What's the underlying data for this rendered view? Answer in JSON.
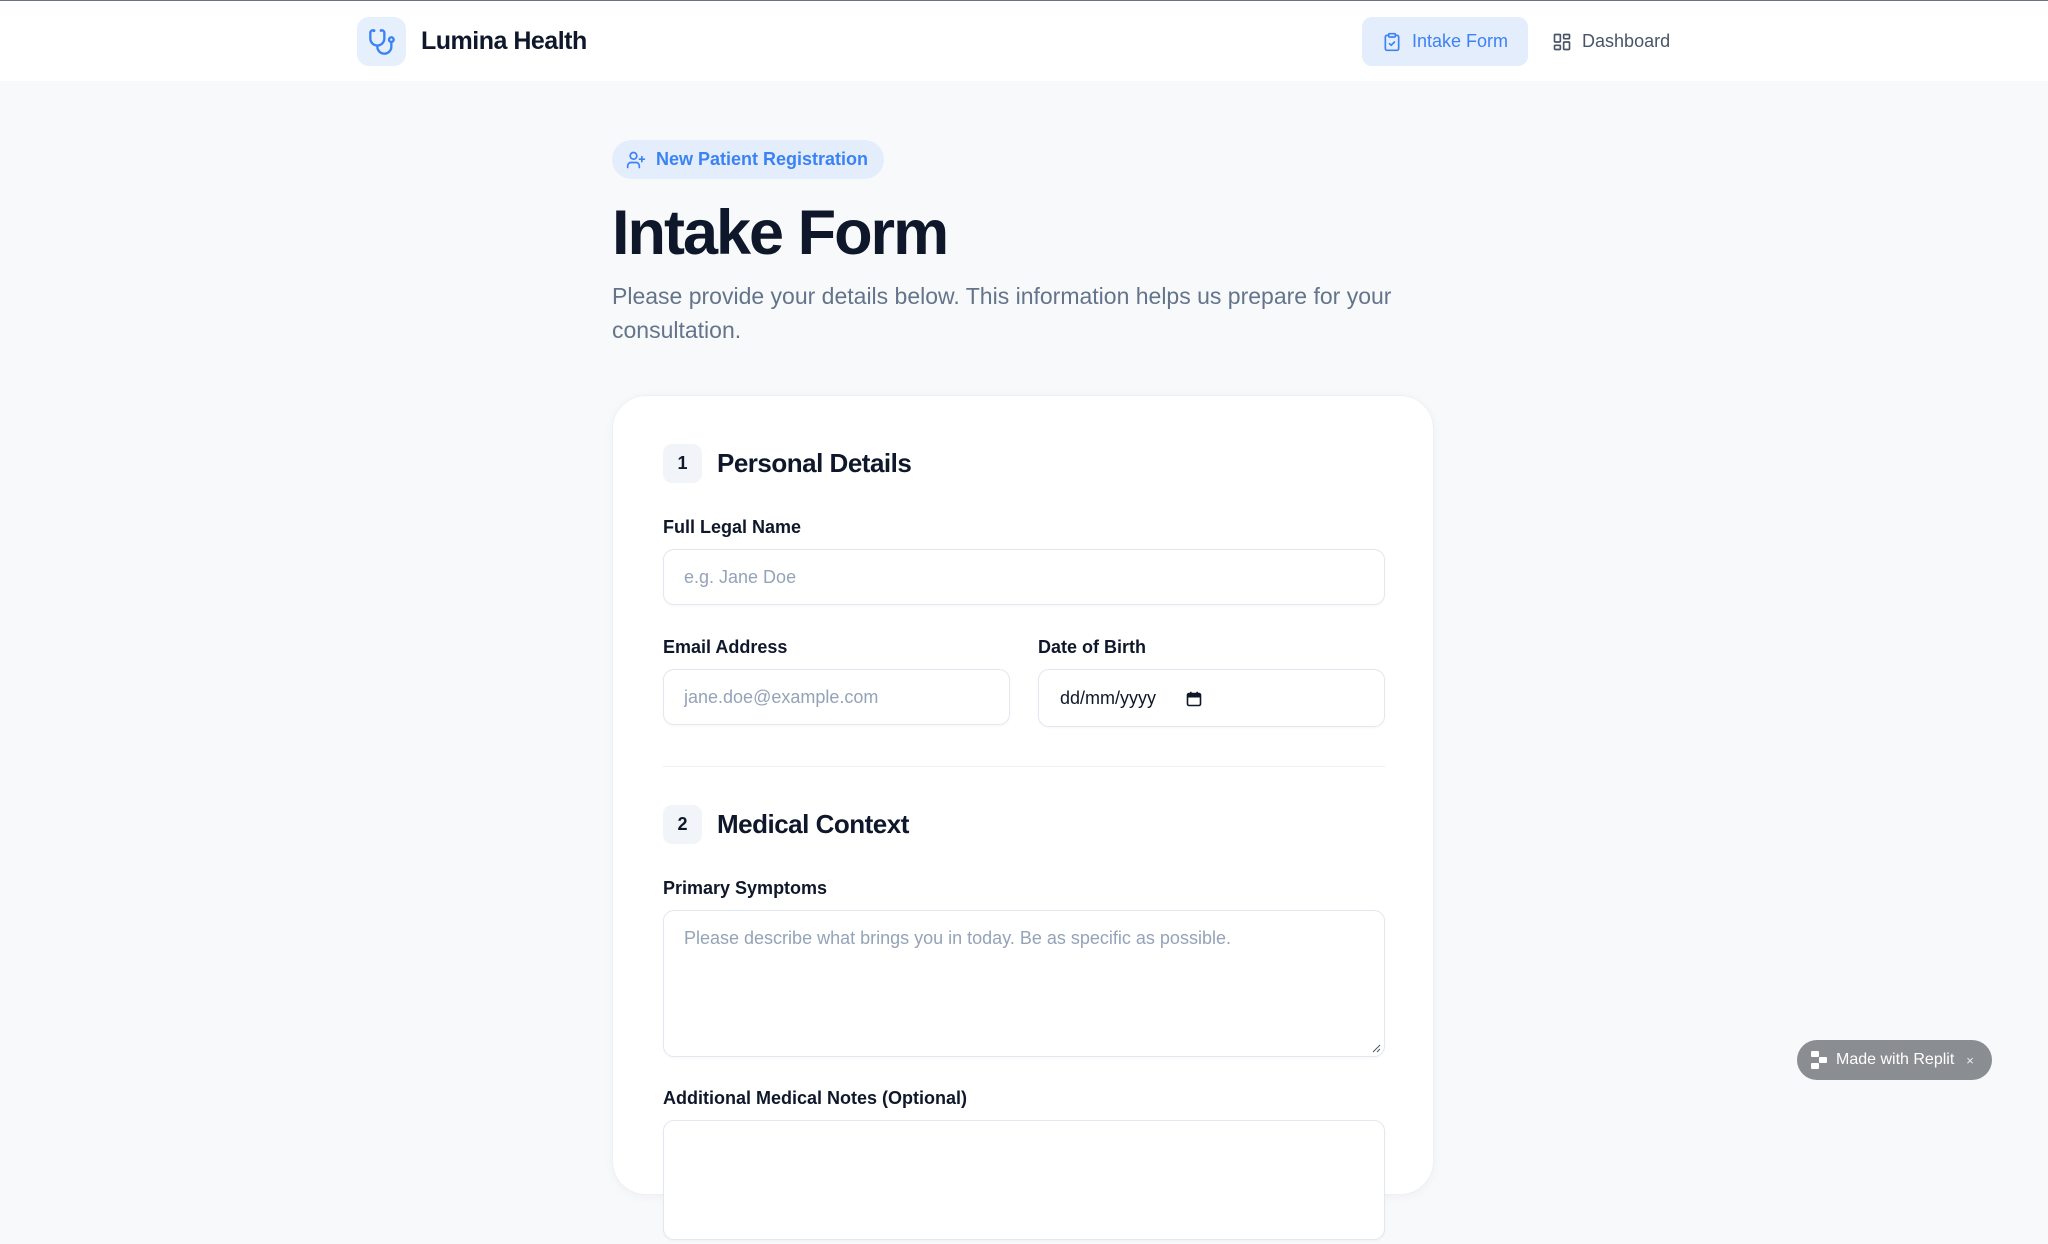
{
  "header": {
    "brand_name": "Lumina Health",
    "brand_icon": "stethoscope-icon",
    "nav": [
      {
        "label": "Intake Form",
        "icon": "clipboard-icon",
        "active": true
      },
      {
        "label": "Dashboard",
        "icon": "layout-grid-icon",
        "active": false
      }
    ]
  },
  "intro": {
    "badge": "New Patient Registration",
    "badge_icon": "user-plus-icon",
    "title": "Intake Form",
    "description": "Please provide your details below. This information helps us prepare for your consultation."
  },
  "form": {
    "sections": [
      {
        "number": "1",
        "title": "Personal Details",
        "fields": [
          {
            "label": "Full Legal Name",
            "placeholder": "e.g. Jane Doe",
            "value": ""
          },
          {
            "label": "Email Address",
            "placeholder": "jane.doe@example.com",
            "value": ""
          },
          {
            "label": "Date of Birth",
            "display": "dd/mm/yyyy",
            "icon": "calendar-icon"
          }
        ]
      },
      {
        "number": "2",
        "title": "Medical Context",
        "fields": [
          {
            "label": "Primary Symptoms",
            "placeholder": "Please describe what brings you in today. Be as specific as possible.",
            "value": ""
          },
          {
            "label": "Additional Medical Notes (Optional)",
            "placeholder": "",
            "value": ""
          }
        ]
      }
    ]
  },
  "badge": {
    "label": "Made with Replit",
    "close": "×"
  },
  "colors": {
    "accent": "#3b82f6",
    "accent_soft": "#e4edfc",
    "background": "#f8f9fa",
    "text": "#0f172a",
    "muted": "#64748b"
  }
}
